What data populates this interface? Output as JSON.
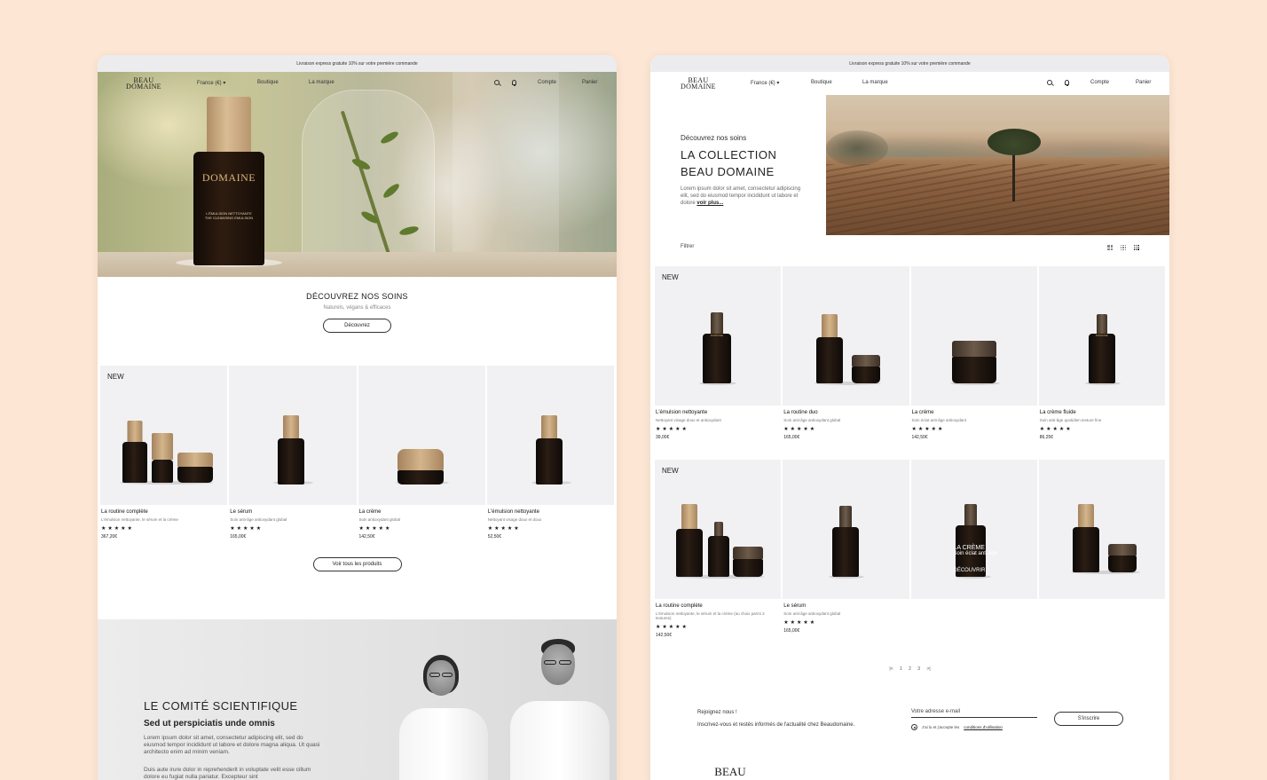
{
  "colors": {
    "background": "#fde6d4",
    "card_bg": "#f1f1f3",
    "text": "#1a1a1a",
    "accent_gold": "#c9a86b"
  },
  "left": {
    "announcement": "Livraison express gratuite 10% sur votre première commande",
    "nav": {
      "logo_line1": "BEAU",
      "logo_line2": "DOMAINE",
      "country": "France (€)",
      "shop": "Boutique",
      "brand": "La marque",
      "account": "Compte",
      "cart": "Panier",
      "icons": [
        "search-icon",
        "bell-icon",
        "chevron-down-icon"
      ]
    },
    "hero_bottle": {
      "logo": "DOMAINE",
      "line1": "L'ÉMULSION NETTOYANTE",
      "line2": "THE CLEANSING EMULSION"
    },
    "discover": {
      "title": "DÉCOUVREZ NOS SOINS",
      "subtitle": "Naturels, végans & efficaces",
      "button": "Découvrez"
    },
    "products": [
      {
        "badge": "NEW",
        "name": "La routine complète",
        "desc": "L'émulsion nettoyante, le sérum et la crème",
        "stars": "★★★★★",
        "price": "367,20€"
      },
      {
        "badge": "",
        "name": "Le sérum",
        "desc": "Soin anti-âge antioxydant global",
        "stars": "★★★★★",
        "price": "165,00€"
      },
      {
        "badge": "",
        "name": "La crème",
        "desc": "Soin antioxydant global",
        "stars": "★★★★★",
        "price": "142,50€"
      },
      {
        "badge": "",
        "name": "L'émulsion nettoyante",
        "desc": "Nettoyant visage doux et doux",
        "stars": "★★★★★",
        "price": "52,50€"
      }
    ],
    "all_products_button": "Voir tous les produits",
    "science": {
      "title": "LE COMITÉ SCIENTIFIQUE",
      "subtitle": "Sed ut perspiciatis unde omnis",
      "p1": "Lorem ipsum dolor sit amet, consectetur adipiscing elit, sed do eiusmod tempor incididunt ut labore et dolore magna aliqua. Ut quasi architecto enim ad minim veniam.",
      "p2": "Duis aute irure dolor in reprehenderit in voluptate velit esse cillum dolore eu fugiat nulla pariatur. Excepteur sint"
    }
  },
  "right": {
    "announcement": "Livraison express gratuite 10% sur votre première commande",
    "nav": {
      "logo_line1": "BEAU",
      "logo_line2": "DOMAINE",
      "country": "France (€)",
      "shop": "Boutique",
      "brand": "La marque",
      "account": "Compte",
      "cart": "Panier"
    },
    "collection": {
      "kicker": "Découvrez nos soins",
      "title_line1": "LA COLLECTION",
      "title_line2": "BEAU DOMAINE",
      "text": "Lorem ipsum dolor sit amet, consectetur adipiscing elit, sed do eiusmod tempor incididunt ut labore et dolore",
      "more": "voir plus..."
    },
    "filter": "Filtrer",
    "view_icons": [
      "grid-2-icon",
      "grid-3-icon",
      "grid-4-icon"
    ],
    "products_row1": [
      {
        "badge": "NEW",
        "name": "L'émulsion nettoyante",
        "desc": "Nettoyant visage doux et antioxydant",
        "stars": "★★★★★",
        "price": "39,00€"
      },
      {
        "badge": "",
        "name": "La routine duo",
        "desc": "Soin anti-âge antioxydant global",
        "stars": "★★★★★",
        "price": "165,00€"
      },
      {
        "badge": "",
        "name": "La crème",
        "desc": "Soin éclat anti-âge antioxydant",
        "stars": "★★★★★",
        "price": "142,50€"
      },
      {
        "badge": "",
        "name": "La crème fluide",
        "desc": "Soin anti-âge quotidien texture fine",
        "stars": "★★★★★",
        "price": "86,25€"
      }
    ],
    "products_row2": [
      {
        "badge": "NEW",
        "name": "La routine complète",
        "desc": "L'émulsion nettoyante, le sérum et la crème (au choix parmi 2 textures)",
        "stars": "★★★★★",
        "price": "142,50€"
      },
      {
        "badge": "",
        "name": "Le sérum",
        "desc": "Soin anti-âge antioxydant global",
        "stars": "★★★★★",
        "price": "165,00€"
      },
      {
        "badge": "",
        "name": "",
        "desc": "",
        "stars": "",
        "price": "",
        "overlay_title": "LA CRÈME",
        "overlay_sub": "Soin éclat anti-âge",
        "overlay_cta": "DÉCOUVRIR"
      },
      {
        "badge": "",
        "name": "",
        "desc": "",
        "stars": "",
        "price": ""
      }
    ],
    "pagination": {
      "prev": "|<",
      "p1": "1",
      "p2": "2",
      "p3": "3",
      "next": ">|"
    },
    "newsletter": {
      "line1": "Rejoignez nous !",
      "line2": "Inscrivez-vous et restés informés de l'actualité chez Beaudomaine.",
      "email_placeholder": "Votre adresse e-mail",
      "consent": "J'ai lu et j'accepte les",
      "consent_link": "conditions d'utilisation",
      "button": "S'inscrire"
    },
    "footer_logo": "BEAU"
  }
}
